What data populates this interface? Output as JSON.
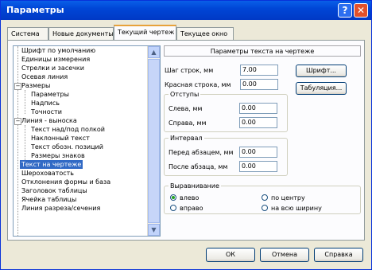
{
  "window": {
    "title": "Параметры",
    "help_glyph": "?",
    "close_glyph": "✕"
  },
  "tabs": [
    {
      "label": "Система"
    },
    {
      "label": "Новые документы"
    },
    {
      "label": "Текущий чертеж"
    },
    {
      "label": "Текущее окно"
    }
  ],
  "tree": {
    "items": [
      {
        "label": "Шрифт по умолчанию"
      },
      {
        "label": "Единицы измерения"
      },
      {
        "label": "Стрелки и засечки"
      },
      {
        "label": "Осевая линия"
      },
      {
        "label": "Размеры"
      },
      {
        "label": "Параметры"
      },
      {
        "label": "Надпись"
      },
      {
        "label": "Точности"
      },
      {
        "label": "Линия - выноска"
      },
      {
        "label": "Текст над/под полкой"
      },
      {
        "label": "Наклонный текст"
      },
      {
        "label": "Текст обозн. позиций"
      },
      {
        "label": "Размеры знаков"
      },
      {
        "label": "Текст на чертеже"
      },
      {
        "label": "Шероховатость"
      },
      {
        "label": "Отклонения формы и база"
      },
      {
        "label": "Заголовок таблицы"
      },
      {
        "label": "Ячейка таблицы"
      },
      {
        "label": "Линия разреза/сечения"
      }
    ]
  },
  "settings": {
    "header": "Параметры текста на чертеже",
    "line_spacing_label": "Шаг строк, мм",
    "line_spacing_value": "7.00",
    "indent_label": "Красная строка, мм",
    "indent_value": "0.00",
    "font_button": "Шрифт...",
    "tab_button": "Табуляция...",
    "margins": {
      "title": "Отступы",
      "left_label": "Слева, мм",
      "left_value": "0.00",
      "right_label": "Справа, мм",
      "right_value": "0.00"
    },
    "interval": {
      "title": "Интервал",
      "before_label": "Перед абзацем, мм",
      "before_value": "0.00",
      "after_label": "После абзаца, мм",
      "after_value": "0.00"
    },
    "align": {
      "title": "Выравнивание",
      "left": "влево",
      "center": "по центру",
      "right": "вправо",
      "justify": "на всю ширину",
      "selected": "влево"
    }
  },
  "footer": {
    "ok": "ОК",
    "cancel": "Отмена",
    "help": "Справка"
  }
}
